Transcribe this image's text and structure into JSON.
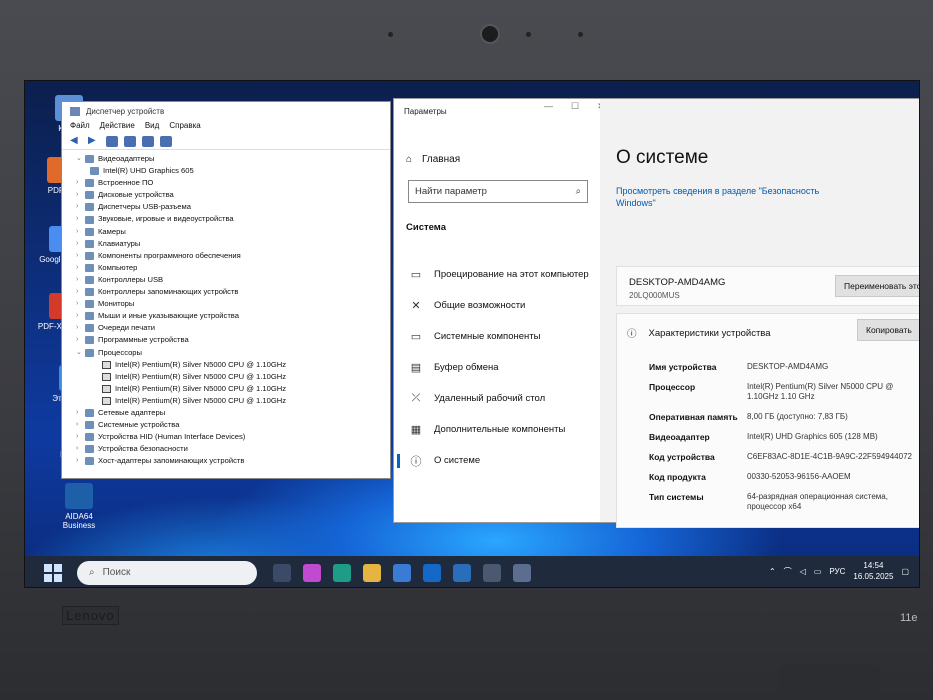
{
  "device_manager": {
    "title": "Диспетчер устройств",
    "menu": [
      "Файл",
      "Действие",
      "Вид",
      "Справка"
    ],
    "tree": [
      {
        "label": "Видеоадаптеры",
        "expanded": true,
        "children": [
          "Intel(R) UHD Graphics 605"
        ]
      },
      {
        "label": "Встроенное ПО"
      },
      {
        "label": "Дисковые устройства"
      },
      {
        "label": "Диспетчеры USB-разъема"
      },
      {
        "label": "Звуковые, игровые и видеоустройства"
      },
      {
        "label": "Камеры"
      },
      {
        "label": "Клавиатуры"
      },
      {
        "label": "Компоненты программного обеспечения"
      },
      {
        "label": "Компьютер"
      },
      {
        "label": "Контроллеры USB"
      },
      {
        "label": "Контроллеры запоминающих устройств"
      },
      {
        "label": "Мониторы"
      },
      {
        "label": "Мыши и иные указывающие устройства"
      },
      {
        "label": "Очереди печати"
      },
      {
        "label": "Программные устройства"
      },
      {
        "label": "Процессоры",
        "expanded": true,
        "children": [
          "Intel(R) Pentium(R) Silver N5000 CPU @ 1.10GHz",
          "Intel(R) Pentium(R) Silver N5000 CPU @ 1.10GHz",
          "Intel(R) Pentium(R) Silver N5000 CPU @ 1.10GHz",
          "Intel(R) Pentium(R) Silver N5000 CPU @ 1.10GHz"
        ]
      },
      {
        "label": "Сетевые адаптеры"
      },
      {
        "label": "Системные устройства"
      },
      {
        "label": "Устройства HID (Human Interface Devices)"
      },
      {
        "label": "Устройства безопасности"
      },
      {
        "label": "Хост-адаптеры запоминающих устройств"
      }
    ]
  },
  "settings": {
    "title": "Параметры",
    "home": "Главная",
    "search_placeholder": "Найти параметр",
    "section": "Система",
    "nav": [
      {
        "icon": "▭",
        "label": "Проецирование на этот компьютер"
      },
      {
        "icon": "✕",
        "label": "Общие возможности"
      },
      {
        "icon": "▭",
        "label": "Системные компоненты"
      },
      {
        "icon": "▤",
        "label": "Буфер обмена"
      },
      {
        "icon": "⤫",
        "label": "Удаленный рабочий стол"
      },
      {
        "icon": "▦",
        "label": "Дополнительные компоненты"
      },
      {
        "icon": "ⓘ",
        "label": "О системе"
      }
    ],
    "page_title": "О системе",
    "security_link": "Просмотреть сведения в разделе \"Безопасность Windows\"",
    "pc_name": "DESKTOP-AMD4AMG",
    "pc_model": "20LQ000MUS",
    "rename_button": "Переименовать этот П",
    "specs_title": "Характеристики устройства",
    "copy_button": "Копировать",
    "specs": [
      {
        "key": "Имя устройства",
        "value": "DESKTOP-AMD4AMG"
      },
      {
        "key": "Процессор",
        "value": "Intel(R) Pentium(R) Silver N5000 CPU @ 1.10GHz 1.10 GHz"
      },
      {
        "key": "Оперативная память",
        "value": "8,00 ГБ (доступно: 7,83 ГБ)"
      },
      {
        "key": "Видеоадаптер",
        "value": "Intel(R) UHD Graphics 605 (128 MB)"
      },
      {
        "key": "Код устройства",
        "value": "C6EF83AC-8D1E-4C1B-9A9C-22F594944072"
      },
      {
        "key": "Код продукта",
        "value": "00330-52053-96156-AAOEM"
      },
      {
        "key": "Тип системы",
        "value": "64-разрядная операционная система, процессор x64"
      }
    ]
  },
  "desktop_icons": [
    {
      "label": "Корзи",
      "color": "#5c8fd6"
    },
    {
      "label": "PDF To",
      "color": "#e06a2c"
    },
    {
      "label": "Googl Chrom",
      "color": "#4a8df0"
    },
    {
      "label": "PDF-XC Edito",
      "color": "#d33a2a"
    },
    {
      "label": "Этот компь",
      "color": "#3b8dde"
    },
    {
      "label": "PDF-XC Office2",
      "color": "#2a79c9"
    },
    {
      "label": "AIDA64 Business",
      "color": "#1d5fa8"
    }
  ],
  "taskbar": {
    "search_placeholder": "Поиск",
    "language": "РУС",
    "time": "14:54",
    "date": "16.05.2025"
  },
  "bezel": {
    "brand": "Lenovo",
    "model": "11e"
  }
}
